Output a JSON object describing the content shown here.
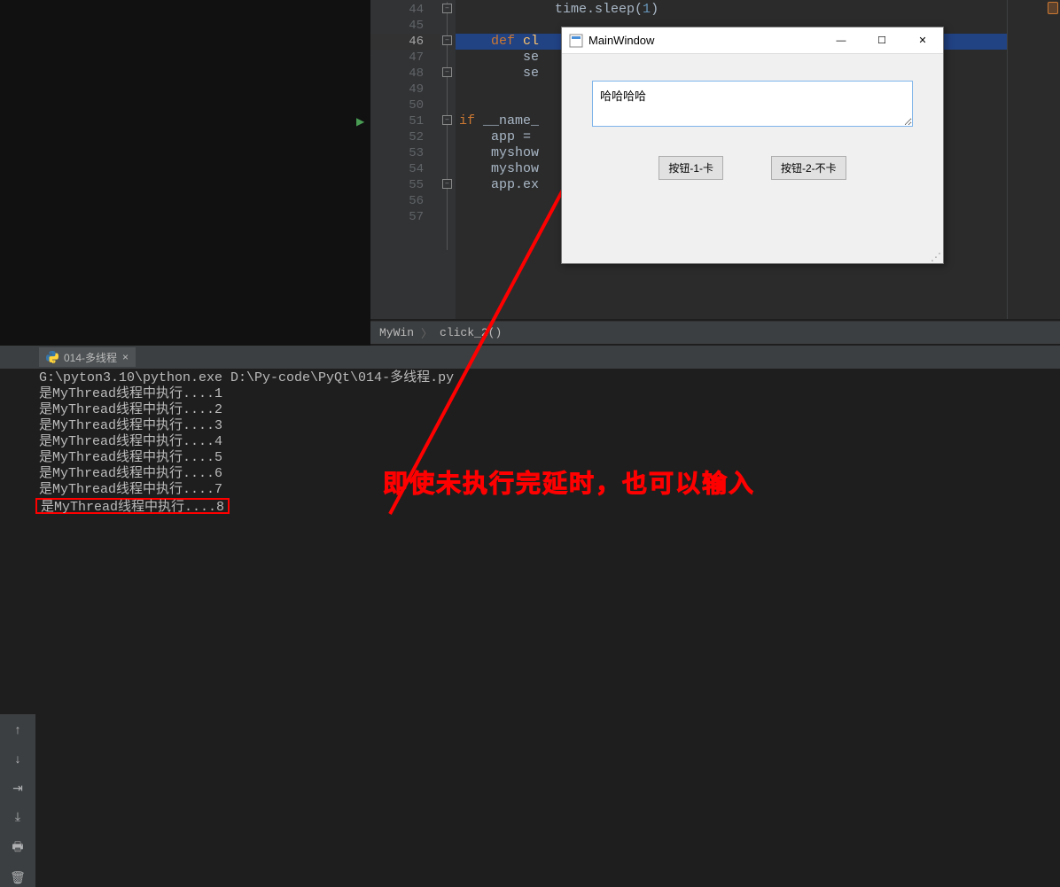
{
  "editor": {
    "lines": [
      {
        "num": "44",
        "html": "            time.sleep(<span class='num'>1</span>)"
      },
      {
        "num": "45",
        "html": ""
      },
      {
        "num": "46",
        "html": "    <span class='kw'>def</span> <span class='fn'>cl</span>",
        "sel": true
      },
      {
        "num": "47",
        "html": "        se"
      },
      {
        "num": "48",
        "html": "        se"
      },
      {
        "num": "49",
        "html": ""
      },
      {
        "num": "50",
        "html": ""
      },
      {
        "num": "51",
        "html": "<span class='kw'>if</span> __name_",
        "run": true
      },
      {
        "num": "52",
        "html": "    app = "
      },
      {
        "num": "53",
        "html": "    myshow"
      },
      {
        "num": "54",
        "html": "    myshow"
      },
      {
        "num": "55",
        "html": "    app.ex"
      },
      {
        "num": "56",
        "html": ""
      },
      {
        "num": "57",
        "html": ""
      }
    ]
  },
  "breadcrumb": {
    "a": "MyWin",
    "b": "click_2()"
  },
  "tab": {
    "label": "014-多线程"
  },
  "terminal": {
    "cmd": "G:\\pyton3.10\\python.exe D:\\Py-code\\PyQt\\014-多线程.py",
    "prefix": "是MyThread线程中执行....",
    "count": 8
  },
  "annotation": "即使未执行完延时，也可以输入",
  "window": {
    "title": "MainWindow",
    "input": "哈哈哈哈",
    "btn1": "按钮-1-卡",
    "btn2": "按钮-2-不卡"
  }
}
